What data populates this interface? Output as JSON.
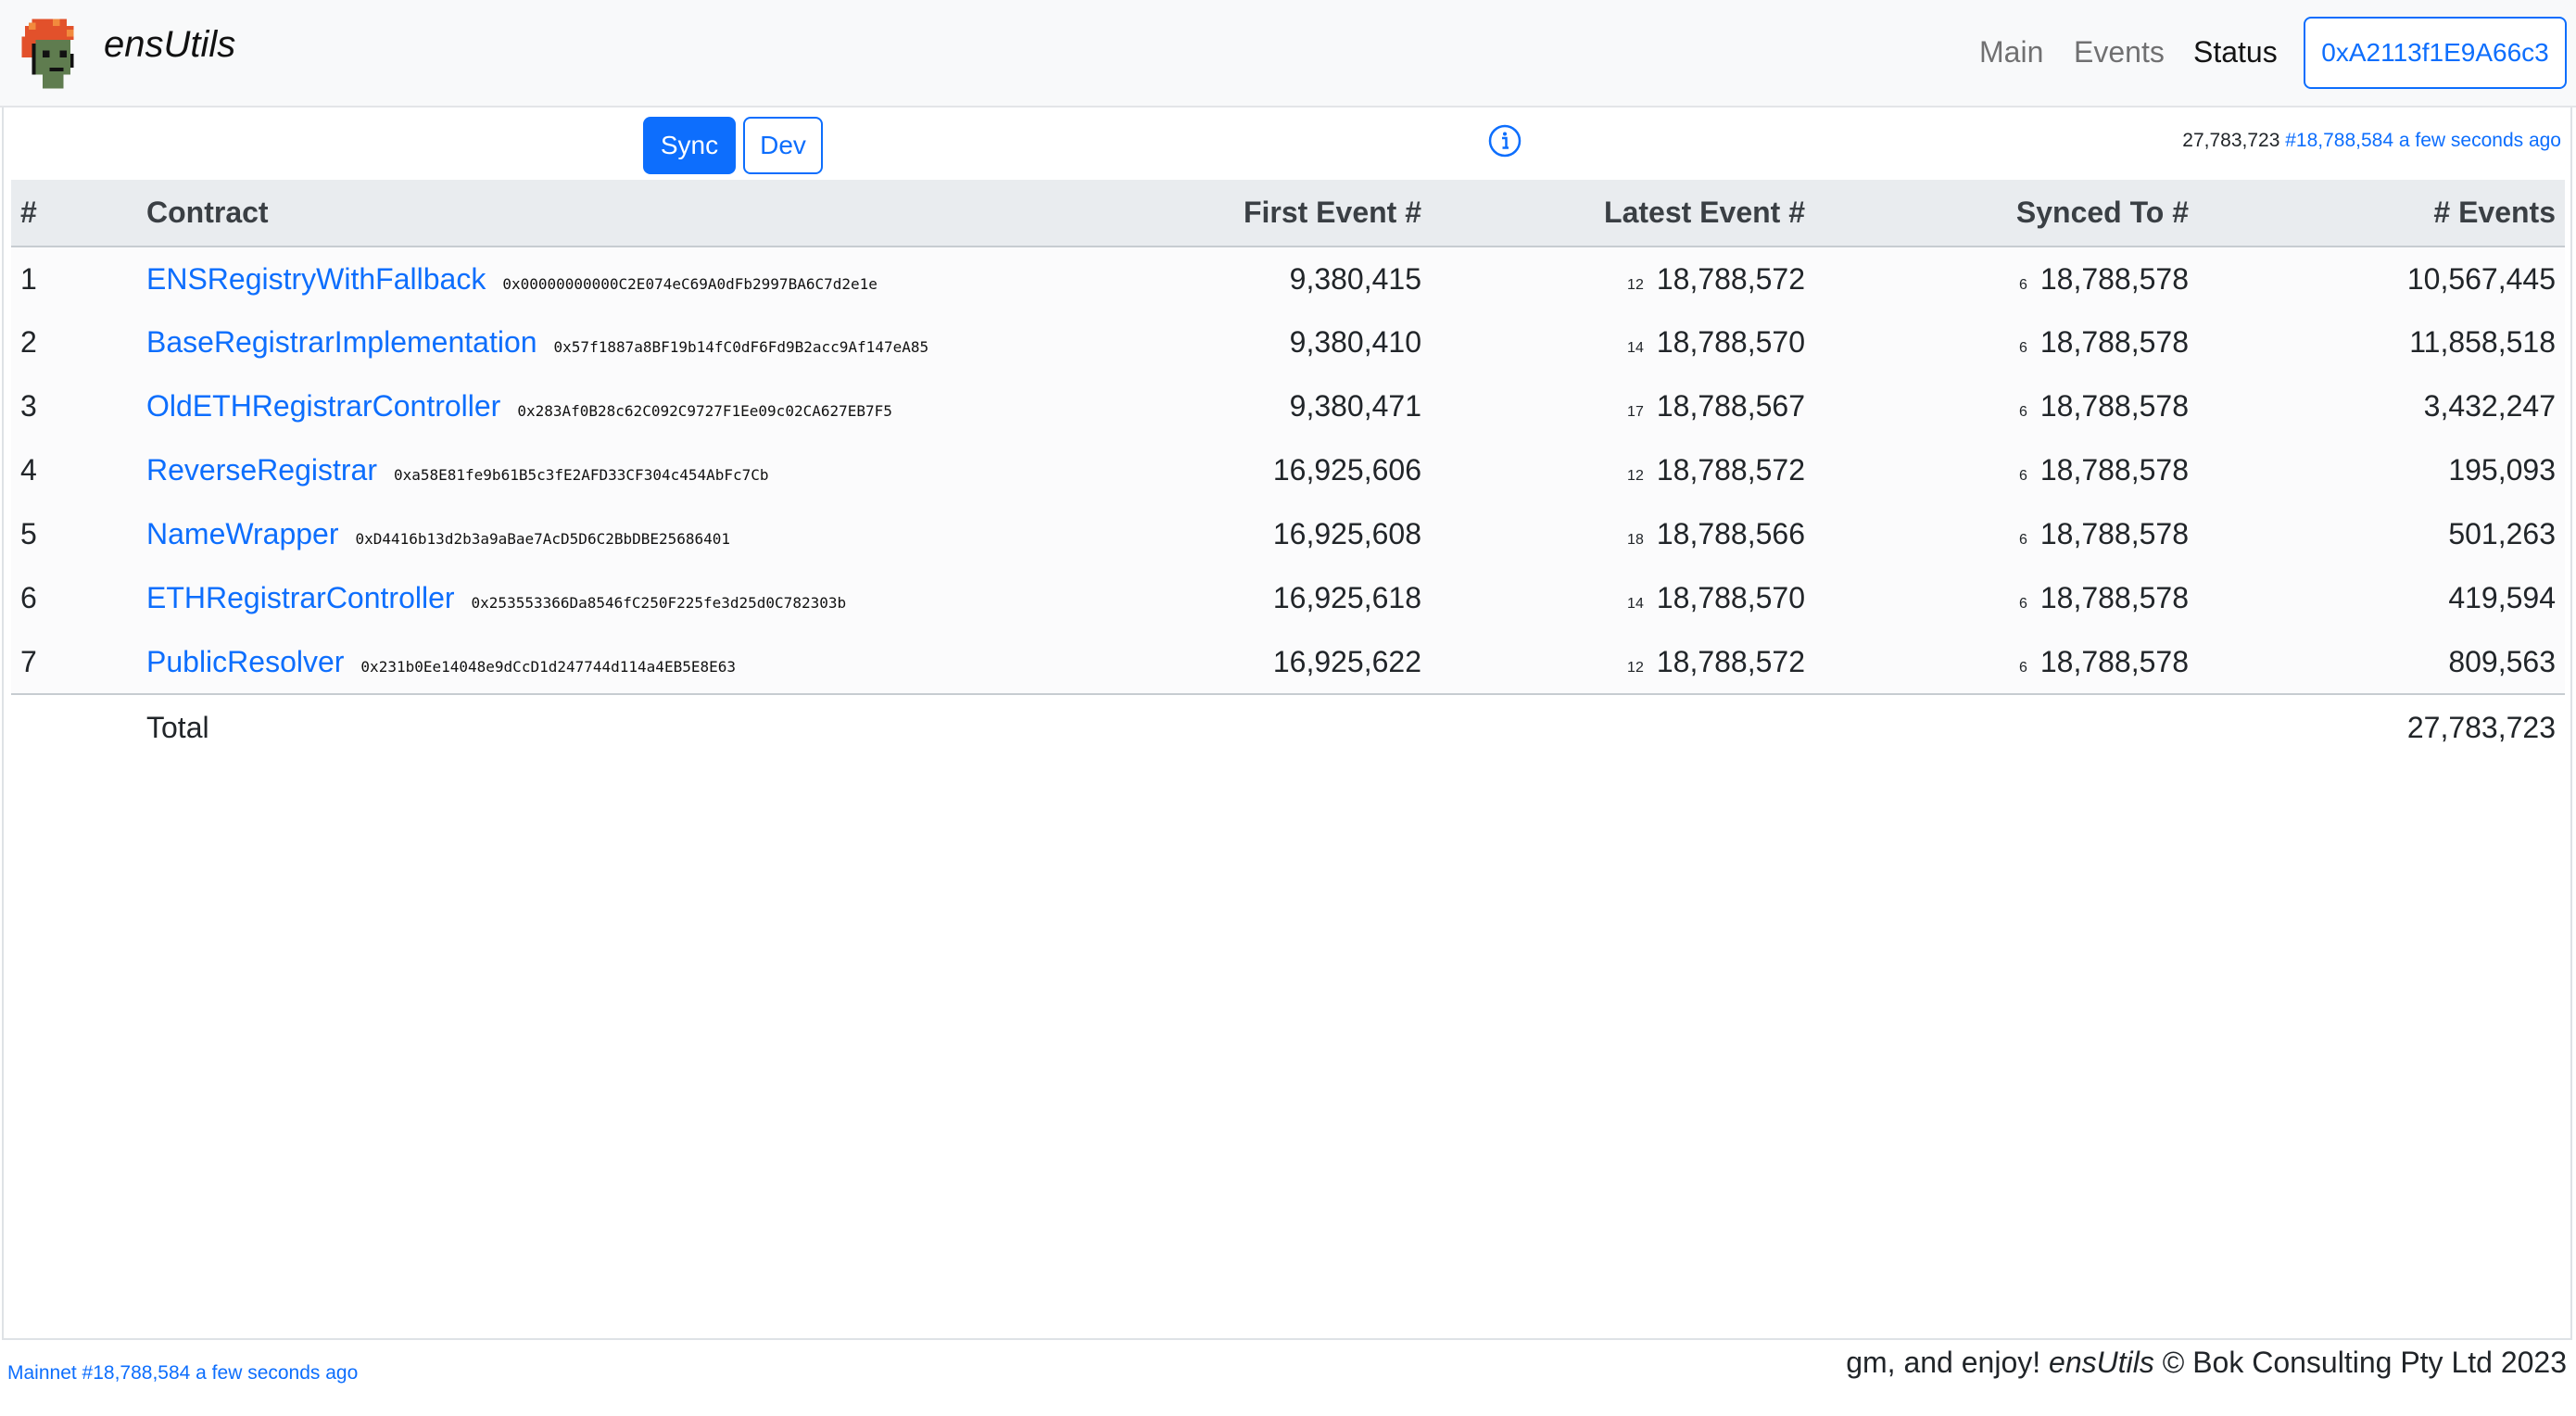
{
  "brand": {
    "name": "ensUtils",
    "logo_icon": "punk-avatar-icon"
  },
  "nav": {
    "items": [
      {
        "label": "Main",
        "active": false
      },
      {
        "label": "Events",
        "active": false
      },
      {
        "label": "Status",
        "active": true
      }
    ],
    "account_label": "0xA2113f1E9A66c3"
  },
  "toolbar": {
    "sync_label": "Sync",
    "dev_label": "Dev",
    "info_icon": "info-circle-icon",
    "total_events": "27,783,723",
    "latest_block": "#18,788,584",
    "latest_block_age": "a few seconds ago"
  },
  "table": {
    "headers": {
      "index": "#",
      "contract": "Contract",
      "first_event": "First Event #",
      "latest_event": "Latest Event #",
      "synced_to": "Synced To #",
      "events": "# Events"
    },
    "rows": [
      {
        "index": "1",
        "name": "ENSRegistryWithFallback",
        "address": "0x00000000000C2E074eC69A0dFb2997BA6C7d2e1e",
        "first_event": "9,380,415",
        "latest_delta": "12",
        "latest_event": "18,788,572",
        "synced_delta": "6",
        "synced_to": "18,788,578",
        "events": "10,567,445"
      },
      {
        "index": "2",
        "name": "BaseRegistrarImplementation",
        "address": "0x57f1887a8BF19b14fC0dF6Fd9B2acc9Af147eA85",
        "first_event": "9,380,410",
        "latest_delta": "14",
        "latest_event": "18,788,570",
        "synced_delta": "6",
        "synced_to": "18,788,578",
        "events": "11,858,518"
      },
      {
        "index": "3",
        "name": "OldETHRegistrarController",
        "address": "0x283Af0B28c62C092C9727F1Ee09c02CA627EB7F5",
        "first_event": "9,380,471",
        "latest_delta": "17",
        "latest_event": "18,788,567",
        "synced_delta": "6",
        "synced_to": "18,788,578",
        "events": "3,432,247"
      },
      {
        "index": "4",
        "name": "ReverseRegistrar",
        "address": "0xa58E81fe9b61B5c3fE2AFD33CF304c454AbFc7Cb",
        "first_event": "16,925,606",
        "latest_delta": "12",
        "latest_event": "18,788,572",
        "synced_delta": "6",
        "synced_to": "18,788,578",
        "events": "195,093"
      },
      {
        "index": "5",
        "name": "NameWrapper",
        "address": "0xD4416b13d2b3a9aBae7AcD5D6C2BbDBE25686401",
        "first_event": "16,925,608",
        "latest_delta": "18",
        "latest_event": "18,788,566",
        "synced_delta": "6",
        "synced_to": "18,788,578",
        "events": "501,263"
      },
      {
        "index": "6",
        "name": "ETHRegistrarController",
        "address": "0x253553366Da8546fC250F225fe3d25d0C782303b",
        "first_event": "16,925,618",
        "latest_delta": "14",
        "latest_event": "18,788,570",
        "synced_delta": "6",
        "synced_to": "18,788,578",
        "events": "419,594"
      },
      {
        "index": "7",
        "name": "PublicResolver",
        "address": "0x231b0Ee14048e9dCcD1d247744d114a4EB5E8E63",
        "first_event": "16,925,622",
        "latest_delta": "12",
        "latest_event": "18,788,572",
        "synced_delta": "6",
        "synced_to": "18,788,578",
        "events": "809,563"
      }
    ],
    "total_label": "Total",
    "total_events": "27,783,723"
  },
  "footer": {
    "network_status": "Mainnet #18,788,584 a few seconds ago",
    "tagline_prefix": "gm, and enjoy!",
    "tagline_brand": "ensUtils",
    "tagline_suffix": "© Bok Consulting Pty Ltd 2023"
  },
  "colors": {
    "primary": "#0d6efd",
    "navbar_bg": "#f8f9fa",
    "header_bg": "#e9ecef"
  }
}
